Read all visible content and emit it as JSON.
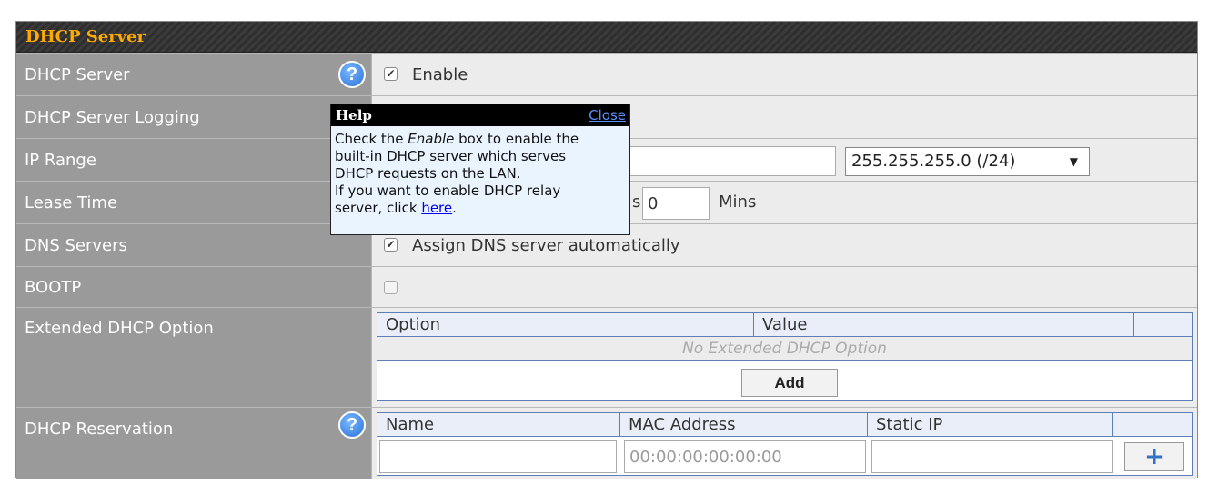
{
  "header": {
    "title": "DHCP Server"
  },
  "rows": {
    "dhcp_server": {
      "label": "DHCP Server",
      "enable_label": "Enable"
    },
    "logging": {
      "label": "DHCP Server Logging"
    },
    "ip_range": {
      "label": "IP Range",
      "subnet_value": "255.255.255.0 (/24)"
    },
    "lease_time": {
      "label": "Lease Time",
      "hours_tail": "s",
      "mins_value": "0",
      "mins_unit": "Mins"
    },
    "dns": {
      "label": "DNS Servers",
      "auto_label": "Assign DNS server automatically"
    },
    "bootp": {
      "label": "BOOTP"
    },
    "extended": {
      "label": "Extended DHCP Option",
      "col_option": "Option",
      "col_value": "Value",
      "empty_text": "No Extended DHCP Option",
      "add_label": "Add"
    },
    "reservation": {
      "label": "DHCP Reservation",
      "col_name": "Name",
      "col_mac": "MAC Address",
      "col_ip": "Static IP",
      "mac_placeholder": "00:00:00:00:00:00",
      "add_icon": "+"
    }
  },
  "help_popup": {
    "title": "Help",
    "close_label": "Close",
    "line1_pre": "Check the ",
    "line1_em": "Enable",
    "line1_post": " box to enable the",
    "line2": "built-in DHCP server which serves",
    "line3": "DHCP requests on the LAN.",
    "line4": "If you want to enable DHCP relay",
    "line5_pre": "server, click ",
    "line5_link": "here",
    "line5_post": "."
  },
  "icons": {
    "help": "question-mark-icon",
    "check": "✔",
    "plus": "plus-icon"
  },
  "colors": {
    "header_text": "#ffaa00",
    "label_bg": "#9a9a9a",
    "value_bg": "#ececec",
    "table_border": "#5c7fb8"
  }
}
